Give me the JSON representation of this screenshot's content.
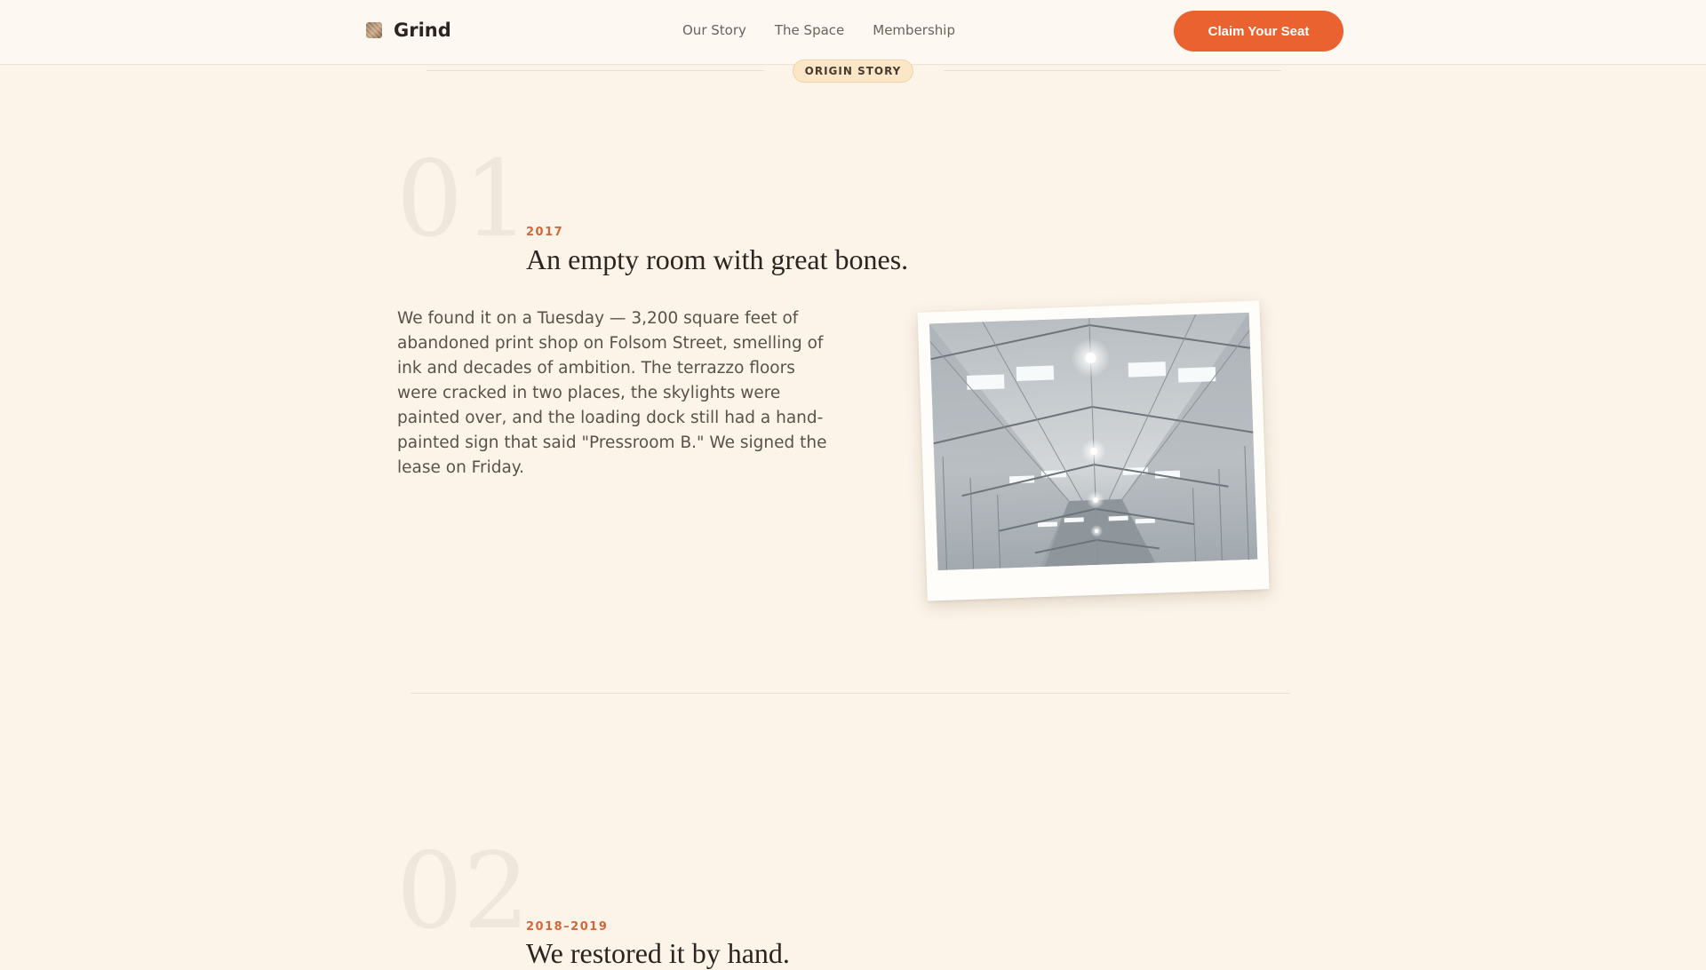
{
  "brand": {
    "name": "Grind"
  },
  "nav": {
    "links": [
      "Our Story",
      "The Space",
      "Membership"
    ]
  },
  "cta": {
    "label": "Claim Your Seat"
  },
  "section_label": "ORIGIN STORY",
  "story": [
    {
      "number": "01",
      "year": "2017",
      "title": "An empty room with great bones.",
      "body": "We found it on a Tuesday — 3,200 square feet of abandoned print shop on Folsom Street, smelling of ink and decades of ambition. The terrazzo floors were cracked in two places, the skylights were painted over, and the loading dock still had a hand-painted sign that said \"Pressroom B.\" We signed the lease on Friday."
    },
    {
      "number": "02",
      "year": "2018–2019",
      "title": "We restored it by hand."
    }
  ],
  "colors": {
    "accent": "#e9622f",
    "background": "#fcf4e9",
    "year": "#d2683a"
  }
}
